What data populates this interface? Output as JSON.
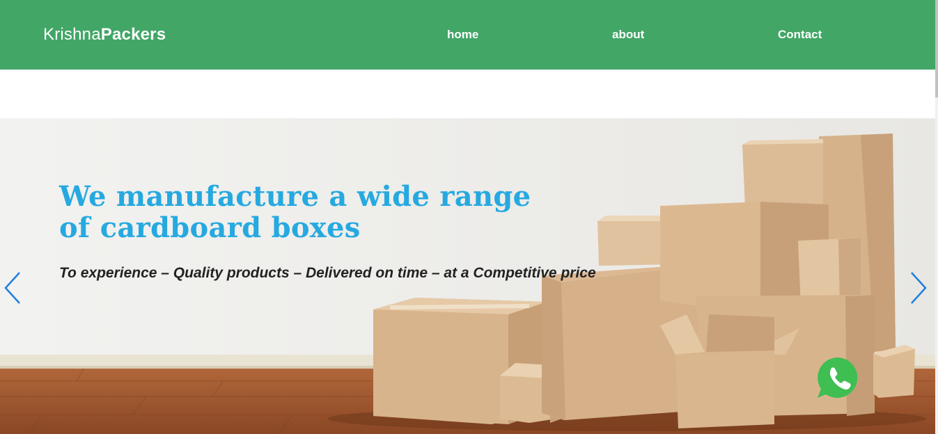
{
  "header": {
    "brand_light": "Krishna",
    "brand_bold": "Packers",
    "nav": {
      "home": "home",
      "about": "about",
      "contact": "Contact"
    },
    "background_color": "#41a666"
  },
  "hero": {
    "title": "We manufacture a wide range of cardboard boxes",
    "subtitle": "To experience – Quality products – Delivered on time – at a Competitive price",
    "title_color": "#26a9e0",
    "prev_icon": "chevron-left-icon",
    "next_icon": "chevron-right-icon"
  },
  "floating": {
    "whatsapp_icon": "whatsapp-icon",
    "whatsapp_color": "#3fbe52"
  }
}
